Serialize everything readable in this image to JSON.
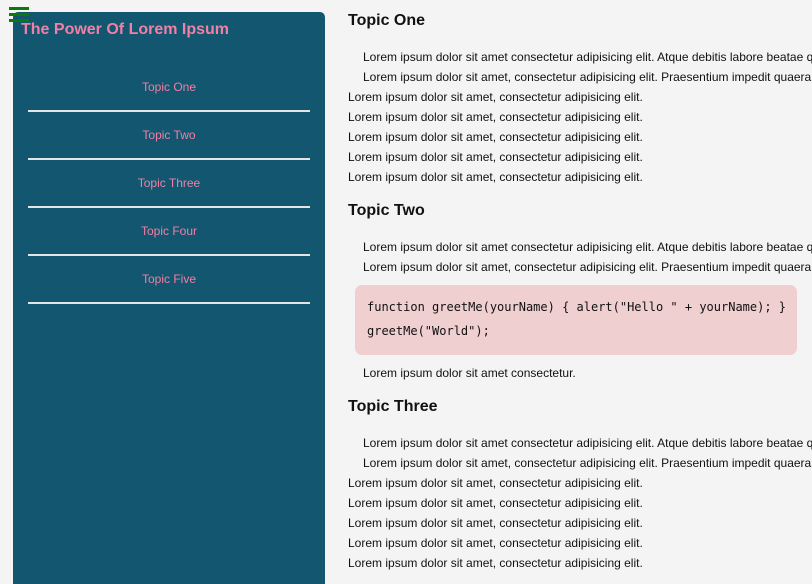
{
  "sidebar": {
    "title": "The Power Of Lorem Ipsum",
    "items": [
      {
        "label": "Topic One"
      },
      {
        "label": "Topic Two"
      },
      {
        "label": "Topic Three"
      },
      {
        "label": "Topic Four"
      },
      {
        "label": "Topic Five"
      }
    ]
  },
  "main": {
    "topic_one": {
      "title": "Topic One",
      "paragraph_1": "Lorem ipsum dolor sit amet consectetur adipisicing elit. Atque debitis labore beatae q",
      "paragraph_2": "Lorem ipsum dolor sit amet, consectetur adipisicing elit. Praesentium impedit quaera",
      "list": [
        "Lorem ipsum dolor sit amet, consectetur adipisicing elit.",
        "Lorem ipsum dolor sit amet, consectetur adipisicing elit.",
        "Lorem ipsum dolor sit amet, consectetur adipisicing elit.",
        "Lorem ipsum dolor sit amet, consectetur adipisicing elit.",
        "Lorem ipsum dolor sit amet, consectetur adipisicing elit."
      ]
    },
    "topic_two": {
      "title": "Topic Two",
      "paragraph_1": "Lorem ipsum dolor sit amet consectetur adipisicing elit. Atque debitis labore beatae q",
      "paragraph_2": "Lorem ipsum dolor sit amet, consectetur adipisicing elit. Praesentium impedit quaera",
      "code_lines": [
        "function greetMe(yourName) { alert(\"Hello \" + yourName); }",
        "greetMe(\"World\");"
      ],
      "paragraph_3": "Lorem ipsum dolor sit amet consectetur."
    },
    "topic_three": {
      "title": "Topic Three",
      "paragraph_1": "Lorem ipsum dolor sit amet consectetur adipisicing elit. Atque debitis labore beatae q",
      "paragraph_2": "Lorem ipsum dolor sit amet, consectetur adipisicing elit. Praesentium impedit quaera",
      "list": [
        "Lorem ipsum dolor sit amet, consectetur adipisicing elit.",
        "Lorem ipsum dolor sit amet, consectetur adipisicing elit.",
        "Lorem ipsum dolor sit amet, consectetur adipisicing elit.",
        "Lorem ipsum dolor sit amet, consectetur adipisicing elit.",
        "Lorem ipsum dolor sit amet, consectetur adipisicing elit."
      ]
    }
  },
  "icons": {
    "menu": "hamburger-icon"
  },
  "colors": {
    "sidebar_bg": "#12576f",
    "accent_pink": "#f27fa6",
    "menu_icon": "#0b7a0b",
    "code_bg": "#f0cfd1",
    "page_bg": "#f4f4f4"
  }
}
